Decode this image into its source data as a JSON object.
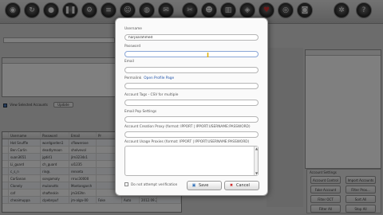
{
  "toolbar": {
    "buttons": [
      {
        "name": "target-icon",
        "glyph": "◉"
      },
      {
        "name": "refresh-icon",
        "glyph": "↻"
      },
      {
        "name": "record-icon",
        "glyph": "●"
      },
      {
        "name": "pause-icon",
        "glyph": "❚❚"
      },
      {
        "name": "settings-icon",
        "glyph": "⚙"
      },
      {
        "name": "list-icon",
        "glyph": "≡"
      },
      {
        "name": "user-icon",
        "glyph": "☺"
      },
      {
        "name": "globe-icon",
        "glyph": "◍"
      },
      {
        "name": "mail-icon",
        "glyph": "✉"
      },
      {
        "name": "tools-icon",
        "glyph": "✂"
      },
      {
        "name": "users-icon",
        "glyph": "☻"
      },
      {
        "name": "stats-icon",
        "glyph": "▥"
      },
      {
        "name": "shield-icon",
        "glyph": "◈"
      },
      {
        "name": "heart-icon",
        "glyph": "♥",
        "red": true
      },
      {
        "name": "disc-icon",
        "glyph": "◎"
      },
      {
        "name": "camera-icon",
        "glyph": "◙"
      },
      {
        "name": "gear-icon",
        "glyph": "✲"
      },
      {
        "name": "help-icon",
        "glyph": "?"
      }
    ]
  },
  "background": {
    "left_panel_options": {
      "view_selected_label": "View Selected Accounts",
      "update_button": "Update"
    },
    "grid": {
      "headers": [
        "",
        "Username",
        "Password",
        "Email",
        "Pr",
        "",
        "",
        ""
      ],
      "rows": [
        [
          "",
          "Hat Snuffle",
          "wordgarden1",
          "cflowerove",
          "",
          "",
          "",
          ""
        ],
        [
          "",
          "Ben Carlin",
          "deadlymoon",
          "shelvevol",
          "",
          "",
          "",
          ""
        ],
        [
          "",
          "suan3651",
          "jgdi41",
          "jlm3234s1",
          "",
          "",
          "",
          ""
        ],
        [
          "",
          "Li_guard",
          "ch_guard",
          "ul1235",
          "",
          "",
          "",
          ""
        ],
        [
          "",
          "c_s_n",
          "rin@.",
          "renseta",
          "",
          "",
          "",
          ""
        ],
        [
          "",
          "CarSanan",
          "songamaly",
          "rrruc30000",
          "",
          "",
          "",
          ""
        ],
        [
          "",
          "Clonely",
          "mulanotts",
          "Montangarch",
          "",
          "",
          "",
          ""
        ],
        [
          "",
          "caf",
          "shafteskin",
          "jm343hn",
          "",
          "",
          "",
          ""
        ],
        [
          "",
          "cheaimuppa",
          "clpebnpuf",
          "jm-alga-00",
          "Fake",
          "Auto",
          "2012.09.21",
          ""
        ]
      ]
    },
    "account_settings_panel": {
      "title": "Account Settings",
      "buttons": [
        "Account Control",
        "Import Accounts",
        "Fake Account",
        "Filter Prox...",
        "Filter OCT",
        "Sort All",
        "Filter All",
        "Stop All"
      ]
    }
  },
  "dialog": {
    "fields": {
      "username": {
        "label": "Username",
        "value": "harjaarahmed"
      },
      "password": {
        "label": "Password",
        "value": ""
      },
      "email": {
        "label": "Email",
        "value": ""
      },
      "permalink": {
        "label": "Permalink",
        "link_text": "Open Profile Page",
        "value": ""
      },
      "account_tags": {
        "label": "Account Tags - CSV for multiple",
        "value": ""
      },
      "email_pop_settings": {
        "label": "Email Pop Settings",
        "value": ""
      },
      "account_creation_proxy": {
        "label": "Account Creation Proxy (format: IPPORT | IPPORT:USERNAME:PASSWORD)",
        "value": ""
      },
      "account_usage_proxies": {
        "label": "Account Usage Proxies (format: IPPORT | IPPORT:USERNAME:PASSWORD)",
        "value": ""
      }
    },
    "verify_label": "Do not attempt verification",
    "save_label": "Save",
    "cancel_label": "Cancel"
  }
}
